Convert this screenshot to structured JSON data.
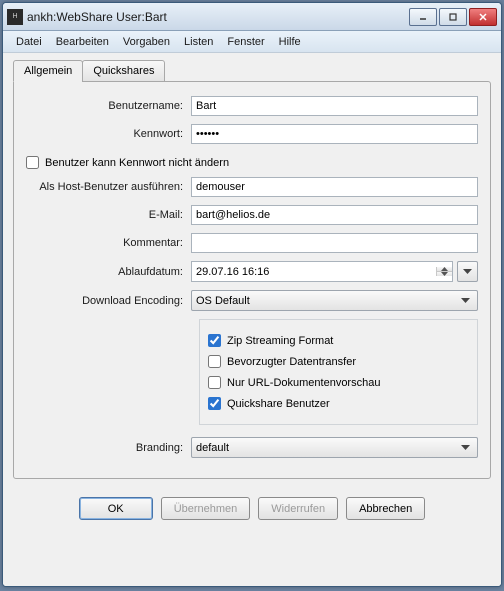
{
  "window": {
    "title": "ankh:WebShare User:Bart"
  },
  "menu": {
    "file": "Datei",
    "edit": "Bearbeiten",
    "defaults": "Vorgaben",
    "lists": "Listen",
    "window": "Fenster",
    "help": "Hilfe"
  },
  "tabs": {
    "general": "Allgemein",
    "quickshares": "Quickshares"
  },
  "labels": {
    "username": "Benutzername:",
    "password": "Kennwort:",
    "hostuser": "Als Host-Benutzer ausführen:",
    "email": "E-Mail:",
    "comment": "Kommentar:",
    "expiry": "Ablaufdatum:",
    "encoding": "Download Encoding:",
    "branding": "Branding:"
  },
  "values": {
    "username": "Bart",
    "password": "••••••",
    "hostuser": "demouser",
    "email": "bart@helios.de",
    "comment": "",
    "expiry": "29.07.16 16:16",
    "encoding": "OS Default",
    "branding": "default"
  },
  "checks": {
    "cannot_change_pw": {
      "label": "Benutzer kann Kennwort nicht ändern",
      "checked": false
    },
    "zip_stream": {
      "label": "Zip Streaming Format",
      "checked": true
    },
    "pref_transfer": {
      "label": "Bevorzugter Datentransfer",
      "checked": false
    },
    "url_preview": {
      "label": "Nur URL-Dokumentenvorschau",
      "checked": false
    },
    "quickshare_user": {
      "label": "Quickshare Benutzer",
      "checked": true
    }
  },
  "buttons": {
    "ok": "OK",
    "apply": "Übernehmen",
    "revert": "Widerrufen",
    "cancel": "Abbrechen"
  }
}
